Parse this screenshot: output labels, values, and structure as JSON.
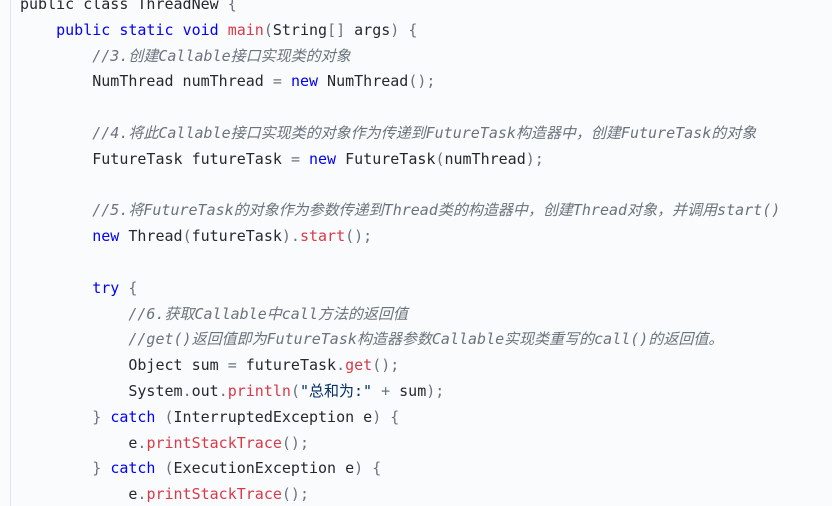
{
  "code": {
    "line_01": [
      {
        "t": "public",
        "k": "kw-plain"
      },
      {
        "t": " ",
        "k": "ident"
      },
      {
        "t": "class",
        "k": "kw-plain"
      },
      {
        "t": " ThreadNew ",
        "k": "ident"
      },
      {
        "t": "{",
        "k": "punct"
      }
    ],
    "line_02": [
      {
        "t": "    ",
        "k": "ident"
      },
      {
        "t": "public",
        "k": "keyword"
      },
      {
        "t": " ",
        "k": "ident"
      },
      {
        "t": "static",
        "k": "keyword"
      },
      {
        "t": " ",
        "k": "ident"
      },
      {
        "t": "void",
        "k": "keyword"
      },
      {
        "t": " ",
        "k": "ident"
      },
      {
        "t": "main",
        "k": "method"
      },
      {
        "t": "(",
        "k": "punct"
      },
      {
        "t": "String",
        "k": "type"
      },
      {
        "t": "[]",
        "k": "punct"
      },
      {
        "t": " args",
        "k": "ident"
      },
      {
        "t": ") {",
        "k": "punct"
      }
    ],
    "line_03": [
      {
        "t": "        ",
        "k": "ident"
      },
      {
        "t": "//3.创建Callable接口实现类的对象",
        "k": "comment"
      }
    ],
    "line_04": [
      {
        "t": "        NumThread numThread ",
        "k": "ident"
      },
      {
        "t": "=",
        "k": "punct"
      },
      {
        "t": " ",
        "k": "ident"
      },
      {
        "t": "new",
        "k": "keyword"
      },
      {
        "t": " NumThread",
        "k": "ident"
      },
      {
        "t": "();",
        "k": "punct"
      }
    ],
    "line_05": [
      {
        "t": " ",
        "k": "ident"
      }
    ],
    "line_06": [
      {
        "t": "        ",
        "k": "ident"
      },
      {
        "t": "//4.将此Callable接口实现类的对象作为传递到FutureTask构造器中，创建FutureTask的对象",
        "k": "comment"
      }
    ],
    "line_07": [
      {
        "t": "        FutureTask futureTask ",
        "k": "ident"
      },
      {
        "t": "=",
        "k": "punct"
      },
      {
        "t": " ",
        "k": "ident"
      },
      {
        "t": "new",
        "k": "keyword"
      },
      {
        "t": " FutureTask",
        "k": "ident"
      },
      {
        "t": "(",
        "k": "punct"
      },
      {
        "t": "numThread",
        "k": "ident"
      },
      {
        "t": ");",
        "k": "punct"
      }
    ],
    "line_08": [
      {
        "t": " ",
        "k": "ident"
      }
    ],
    "line_09": [
      {
        "t": "        ",
        "k": "ident"
      },
      {
        "t": "//5.将FutureTask的对象作为参数传递到Thread类的构造器中，创建Thread对象，并调用start()",
        "k": "comment"
      }
    ],
    "line_10": [
      {
        "t": "        ",
        "k": "ident"
      },
      {
        "t": "new",
        "k": "keyword"
      },
      {
        "t": " Thread",
        "k": "ident"
      },
      {
        "t": "(",
        "k": "punct"
      },
      {
        "t": "futureTask",
        "k": "ident"
      },
      {
        "t": ").",
        "k": "punct"
      },
      {
        "t": "start",
        "k": "method"
      },
      {
        "t": "();",
        "k": "punct"
      }
    ],
    "line_11": [
      {
        "t": " ",
        "k": "ident"
      }
    ],
    "line_12": [
      {
        "t": "        ",
        "k": "ident"
      },
      {
        "t": "try",
        "k": "keyword"
      },
      {
        "t": " ",
        "k": "ident"
      },
      {
        "t": "{",
        "k": "punct"
      }
    ],
    "line_13": [
      {
        "t": "            ",
        "k": "ident"
      },
      {
        "t": "//6.获取Callable中call方法的返回值",
        "k": "comment"
      }
    ],
    "line_14": [
      {
        "t": "            ",
        "k": "ident"
      },
      {
        "t": "//get()返回值即为FutureTask构造器参数Callable实现类重写的call()的返回值。",
        "k": "comment"
      }
    ],
    "line_15": [
      {
        "t": "            Object sum ",
        "k": "ident"
      },
      {
        "t": "=",
        "k": "punct"
      },
      {
        "t": " futureTask",
        "k": "ident"
      },
      {
        "t": ".",
        "k": "punct"
      },
      {
        "t": "get",
        "k": "method"
      },
      {
        "t": "();",
        "k": "punct"
      }
    ],
    "line_16": [
      {
        "t": "            System",
        "k": "ident"
      },
      {
        "t": ".",
        "k": "punct"
      },
      {
        "t": "out",
        "k": "ident"
      },
      {
        "t": ".",
        "k": "punct"
      },
      {
        "t": "println",
        "k": "method"
      },
      {
        "t": "(",
        "k": "punct"
      },
      {
        "t": "\"总和为:\"",
        "k": "string"
      },
      {
        "t": " ",
        "k": "ident"
      },
      {
        "t": "+",
        "k": "punct"
      },
      {
        "t": " sum",
        "k": "ident"
      },
      {
        "t": ");",
        "k": "punct"
      }
    ],
    "line_17": [
      {
        "t": "        ",
        "k": "ident"
      },
      {
        "t": "}",
        "k": "punct"
      },
      {
        "t": " ",
        "k": "ident"
      },
      {
        "t": "catch",
        "k": "keyword"
      },
      {
        "t": " ",
        "k": "ident"
      },
      {
        "t": "(",
        "k": "punct"
      },
      {
        "t": "InterruptedException e",
        "k": "ident"
      },
      {
        "t": ") {",
        "k": "punct"
      }
    ],
    "line_18": [
      {
        "t": "            e",
        "k": "ident"
      },
      {
        "t": ".",
        "k": "punct"
      },
      {
        "t": "printStackTrace",
        "k": "method"
      },
      {
        "t": "();",
        "k": "punct"
      }
    ],
    "line_19": [
      {
        "t": "        ",
        "k": "ident"
      },
      {
        "t": "}",
        "k": "punct"
      },
      {
        "t": " ",
        "k": "ident"
      },
      {
        "t": "catch",
        "k": "keyword"
      },
      {
        "t": " ",
        "k": "ident"
      },
      {
        "t": "(",
        "k": "punct"
      },
      {
        "t": "ExecutionException e",
        "k": "ident"
      },
      {
        "t": ") {",
        "k": "punct"
      }
    ],
    "line_20": [
      {
        "t": "            e",
        "k": "ident"
      },
      {
        "t": ".",
        "k": "punct"
      },
      {
        "t": "printStackTrace",
        "k": "method"
      },
      {
        "t": "();",
        "k": "punct"
      }
    ]
  },
  "colors": {
    "background": "#fafbfc",
    "keyword": "#0000ff",
    "method": "#d73a49",
    "comment": "#6a737d",
    "string": "#032f62",
    "text": "#24292e"
  }
}
